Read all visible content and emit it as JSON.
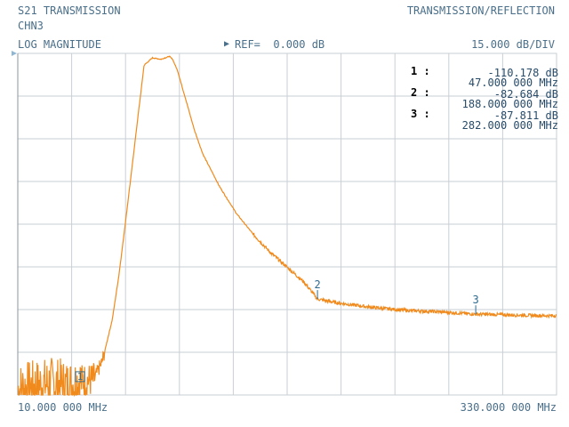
{
  "header": {
    "measurement": "S21 TRANSMISSION",
    "channel": "CHN3",
    "mode": "TRANSMISSION/REFLECTION",
    "format": "LOG MAGNITUDE",
    "ref_arrow": "▶",
    "ref": "REF=  0.000 dB",
    "scale": "15.000 dB/DIV"
  },
  "footer": {
    "start": "10.000 000 MHz",
    "stop": "330.000 000 MHz"
  },
  "markers": [
    {
      "id": "1",
      "label": "1 :",
      "amplitude": "-110.178 dB",
      "frequency": "47.000 000 MHz"
    },
    {
      "id": "2",
      "label": "2 :",
      "amplitude": "-82.684 dB",
      "frequency": "188.000 000 MHz"
    },
    {
      "id": "3",
      "label": "3 :",
      "amplitude": "-87.811 dB",
      "frequency": "282.000 000 MHz"
    }
  ],
  "colors": {
    "trace": "#f08a1c",
    "grid": "#c9cfd6",
    "text": "#4a6f8a",
    "marker": "#2f6b8f"
  },
  "chart_data": {
    "type": "line",
    "x_unit": "MHz",
    "y_unit": "dB",
    "xlim": [
      10,
      330
    ],
    "ylim": [
      -115,
      0
    ],
    "grid": true,
    "x_divisions": 10,
    "y_divisions": 8,
    "series": [
      {
        "x": [
          10,
          20,
          30,
          40,
          47,
          55,
          60,
          63,
          66,
          70,
          75,
          80,
          85,
          90,
          95,
          100,
          102,
          105,
          108,
          110,
          115,
          120,
          130,
          140,
          150,
          160,
          170,
          180,
          188,
          200,
          220,
          240,
          260,
          282,
          300,
          320,
          330
        ],
        "y": [
          -113,
          -112,
          -111,
          -112,
          -110.2,
          -110,
          -104,
          -97,
          -90,
          -75,
          -52,
          -28,
          -4,
          -1.5,
          -2,
          -1,
          -2,
          -6,
          -12,
          -16,
          -26,
          -34,
          -45,
          -54,
          -61,
          -67,
          -72,
          -77,
          -82.7,
          -84,
          -85.5,
          -86.5,
          -87,
          -87.8,
          -88,
          -88.3,
          -88.3
        ]
      }
    ],
    "markers": [
      {
        "id": "1",
        "x": 47,
        "y": -110.178
      },
      {
        "id": "2",
        "x": 188,
        "y": -82.684
      },
      {
        "id": "3",
        "x": 282,
        "y": -87.811
      }
    ]
  }
}
